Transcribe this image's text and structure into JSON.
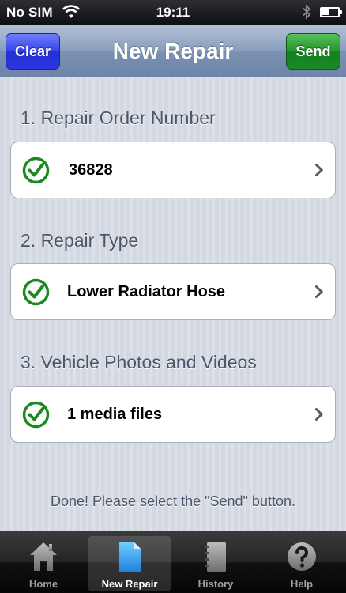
{
  "status_bar": {
    "carrier": "No SIM",
    "time": "19:11"
  },
  "nav": {
    "title": "New Repair",
    "left_button": "Clear",
    "right_button": "Send",
    "left_button_color": "#2b36e0",
    "right_button_color": "#1a8a24"
  },
  "sections": [
    {
      "header": "1. Repair Order Number",
      "value": "36828",
      "status": "check-icon"
    },
    {
      "header": "2. Repair Type",
      "value": "Lower Radiator Hose",
      "status": "check-icon"
    },
    {
      "header": "3. Vehicle Photos and Videos",
      "value": "1 media files",
      "status": "check-icon"
    }
  ],
  "message": "Done! Please select the \"Send\" button.",
  "tabs": [
    {
      "label": "Home",
      "icon": "home-icon",
      "selected": false
    },
    {
      "label": "New Repair",
      "icon": "document-icon",
      "selected": true
    },
    {
      "label": "History",
      "icon": "notebook-icon",
      "selected": false
    },
    {
      "label": "Help",
      "icon": "help-icon",
      "selected": false
    }
  ],
  "colors": {
    "check": "#1b8a1f",
    "nav_bar": "#8a9fbe"
  }
}
